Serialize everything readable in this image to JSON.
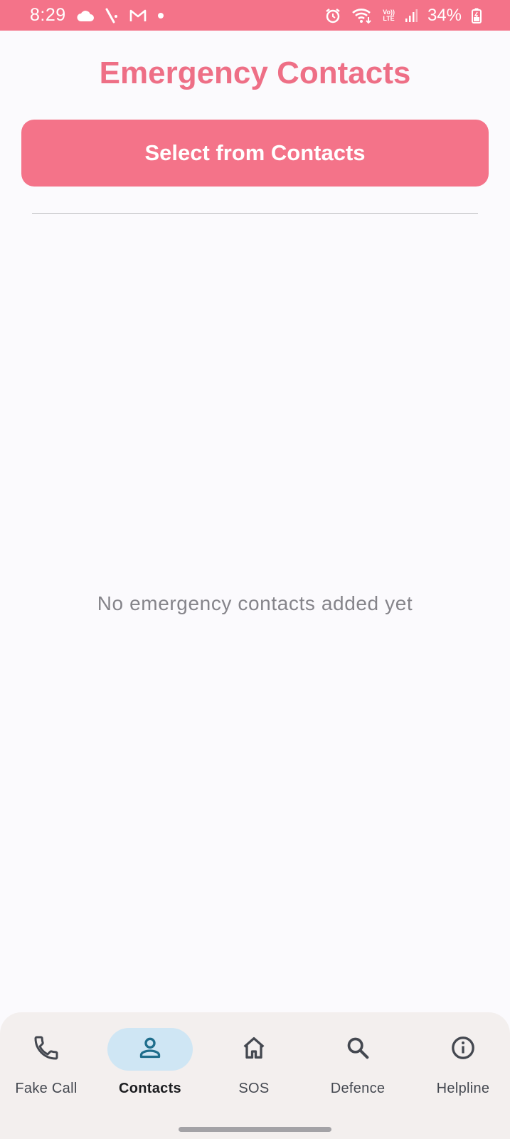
{
  "status_bar": {
    "time": "8:29",
    "battery": "34%",
    "network_label_top": "Vo))",
    "network_label_bottom": "LTE",
    "left_icons": [
      "cloud-icon",
      "slash-app-icon",
      "gmail-icon",
      "dot-icon"
    ],
    "right_icons": [
      "alarm-icon",
      "wifi-icon",
      "lte-icon",
      "signal-icon",
      "battery-icon"
    ]
  },
  "header": {
    "title": "Emergency Contacts",
    "select_button_label": "Select from Contacts"
  },
  "main": {
    "empty_message": "No emergency contacts added yet"
  },
  "bottom_nav": {
    "items": [
      {
        "label": "Fake Call",
        "icon": "phone-icon",
        "active": false
      },
      {
        "label": "Contacts",
        "icon": "person-icon",
        "active": true
      },
      {
        "label": "SOS",
        "icon": "home-icon",
        "active": false
      },
      {
        "label": "Defence",
        "icon": "search-icon",
        "active": false
      },
      {
        "label": "Helpline",
        "icon": "info-icon",
        "active": false
      }
    ]
  },
  "colors": {
    "accent": "#f47389",
    "title": "#ee6f86",
    "active_nav_bg": "#cfe6f4",
    "active_icon": "#1f6e8c"
  }
}
